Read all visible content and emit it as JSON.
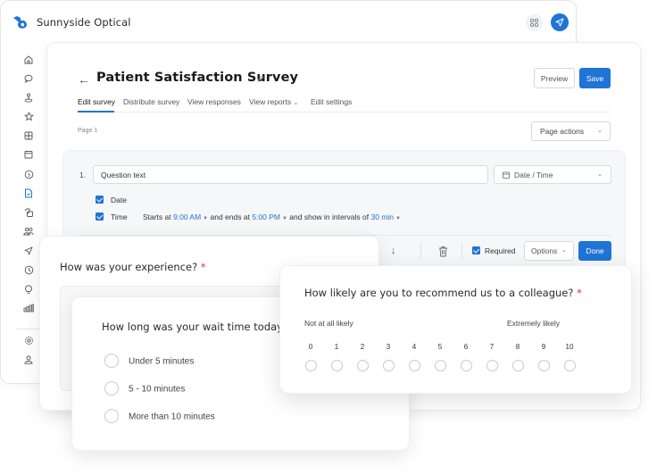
{
  "app": {
    "brand_name": "Sunnyside Optical",
    "accent_color": "#1f74d6",
    "header_icons": [
      "apps-grid-icon",
      "send-icon"
    ]
  },
  "sidebar": {
    "items": [
      {
        "icon": "home-icon"
      },
      {
        "icon": "chat-bubble-icon"
      },
      {
        "icon": "location-pin-icon"
      },
      {
        "icon": "star-icon"
      },
      {
        "icon": "grid-widget-icon"
      },
      {
        "icon": "calendar-icon"
      },
      {
        "icon": "dollar-icon"
      },
      {
        "icon": "document-icon",
        "active": true
      },
      {
        "icon": "tags-icon"
      },
      {
        "icon": "users-icon"
      },
      {
        "icon": "send-icon"
      },
      {
        "icon": "clock-icon"
      },
      {
        "icon": "lightbulb-icon"
      },
      {
        "icon": "bar-chart-icon"
      }
    ],
    "bottom_items": [
      {
        "icon": "settings-icon"
      },
      {
        "icon": "user-icon"
      }
    ]
  },
  "editor": {
    "title": "Patient Satisfaction Survey",
    "preview_label": "Preview",
    "save_label": "Save",
    "tabs": [
      {
        "label": "Edit survey",
        "active": true
      },
      {
        "label": "Distribute survey"
      },
      {
        "label": "View responses"
      },
      {
        "label": "View reports",
        "has_dropdown": true
      },
      {
        "label": "Edit settings"
      }
    ],
    "page_label": "Page 1",
    "page_actions_label": "Page actions",
    "question": {
      "number": "1.",
      "text": "Question text",
      "type": "Date / Time",
      "date_label": "Date",
      "date_checked": true,
      "time_label": "Time",
      "time_checked": true,
      "starts_prefix": "Starts at",
      "start_time": "9:00 AM",
      "ends_prefix": "and ends at",
      "end_time": "5:00 PM",
      "interval_prefix": "and show in intervals of",
      "interval": "30 min",
      "required_label": "Required",
      "required_checked": true,
      "options_label": "Options",
      "done_label": "Done"
    }
  },
  "cards": {
    "experience": {
      "title": "How was your experience?",
      "required_mark": "*"
    },
    "wait_time": {
      "title": "How long was your wait time today?",
      "options": [
        "Under 5 minutes",
        "5 - 10 minutes",
        "More than 10 minutes"
      ]
    },
    "nps": {
      "title": "How likely are you to recommend us to a colleague?",
      "required_mark": "*",
      "low_label": "Not at all likely",
      "high_label": "Extremely likely",
      "scale": [
        "0",
        "1",
        "2",
        "3",
        "4",
        "5",
        "6",
        "7",
        "8",
        "9",
        "10"
      ]
    }
  }
}
